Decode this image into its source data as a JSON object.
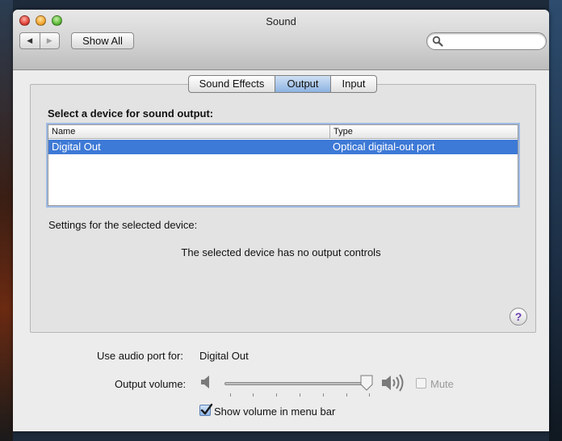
{
  "window": {
    "title": "Sound"
  },
  "toolbar": {
    "back_glyph": "◀",
    "forward_glyph": "▶",
    "show_all_label": "Show All",
    "search_value": ""
  },
  "tabs": [
    {
      "label": "Sound Effects",
      "selected": false
    },
    {
      "label": "Output",
      "selected": true
    },
    {
      "label": "Input",
      "selected": false
    }
  ],
  "output": {
    "select_label": "Select a device for sound output:",
    "columns": [
      "Name",
      "Type"
    ],
    "rows": [
      {
        "name": "Digital Out",
        "type": "Optical digital-out port",
        "selected": true
      }
    ],
    "settings_label": "Settings for the selected device:",
    "no_controls_message": "The selected device has no output controls",
    "help_glyph": "?"
  },
  "bottom": {
    "port_label": "Use audio port for:",
    "port_value": "Digital Out",
    "volume_label": "Output volume:",
    "volume_level": 0.98,
    "mute_label": "Mute",
    "mute_checked": false,
    "mute_enabled": false,
    "menu_bar_label": "Show volume in menu bar",
    "menu_bar_checked": true
  },
  "icons": {
    "search": "search-icon",
    "speaker_low": "speaker-low-icon",
    "speaker_high": "speaker-high-icon",
    "help": "help-icon"
  },
  "colors": {
    "selection": "#3d79d6",
    "tab_selected": "#8db3e2",
    "help_glyph": "#6a3fb0"
  }
}
